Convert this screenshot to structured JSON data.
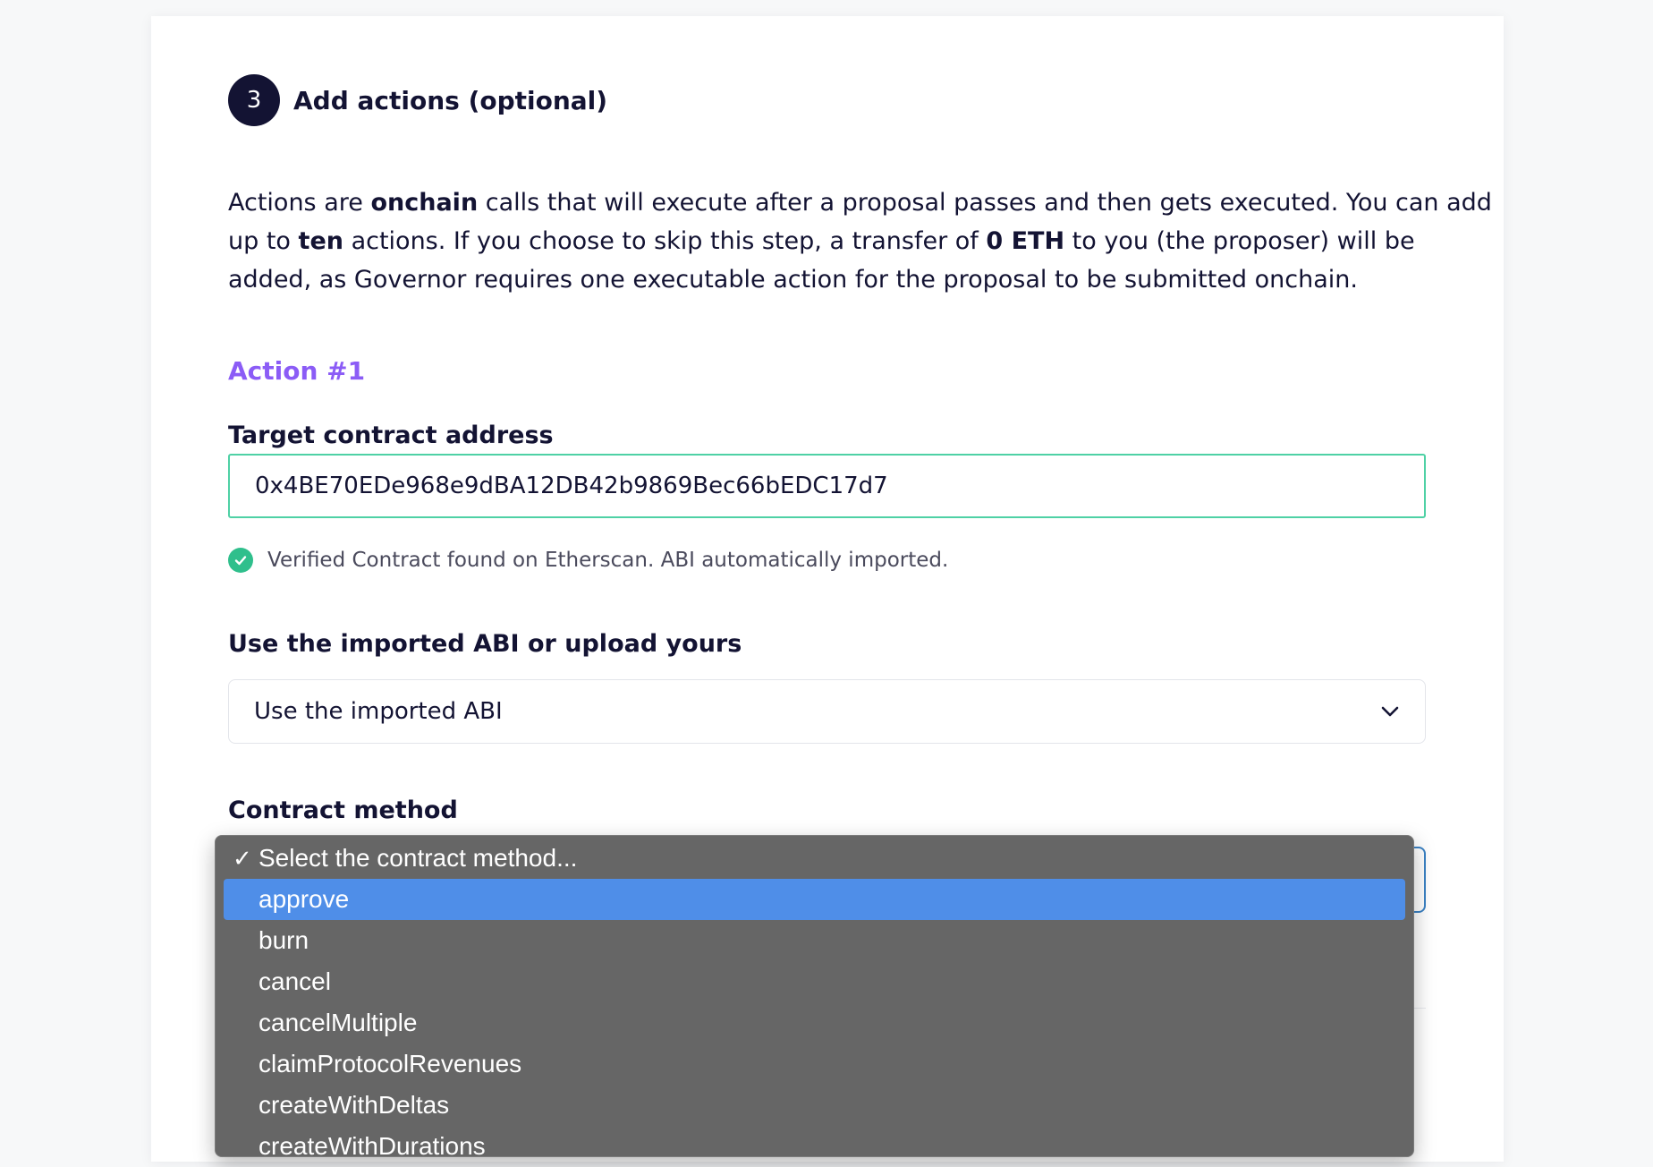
{
  "step": {
    "number": "3",
    "title": "Add actions (optional)"
  },
  "description": {
    "part1": "Actions are ",
    "bold1": "onchain",
    "part2": " calls that will execute after a proposal passes and then gets executed. You can add up to ",
    "bold2": "ten",
    "part3": " actions. If you choose to skip this step, a transfer of ",
    "bold3": "0 ETH",
    "part4": " to you (the proposer) will be added, as Governor requires one executable action for the proposal to be submitted onchain."
  },
  "action": {
    "heading": "Action #1",
    "target_label": "Target contract address",
    "target_value": "0x4BE70EDe968e9dBA12DB42b9869Bec66bEDC17d7",
    "verified_text": "Verified Contract found on Etherscan. ABI automatically imported.",
    "abi_label": "Use the imported ABI or upload yours",
    "abi_value": "Use the imported ABI",
    "method_label": "Contract method"
  },
  "dropdown": {
    "items": [
      {
        "label": "Select the contract method...",
        "checked": "✓"
      },
      {
        "label": "approve"
      },
      {
        "label": "burn"
      },
      {
        "label": "cancel"
      },
      {
        "label": "cancelMultiple"
      },
      {
        "label": "claimProtocolRevenues"
      },
      {
        "label": "createWithDeltas"
      },
      {
        "label": "createWithDurations"
      }
    ]
  },
  "colors": {
    "accent_purple": "#8b5cf6",
    "success_green": "#2fbf8c",
    "input_border_green": "#4fd1a5",
    "focus_blue": "#3b82c4",
    "menu_highlight": "#4f8ee8"
  }
}
